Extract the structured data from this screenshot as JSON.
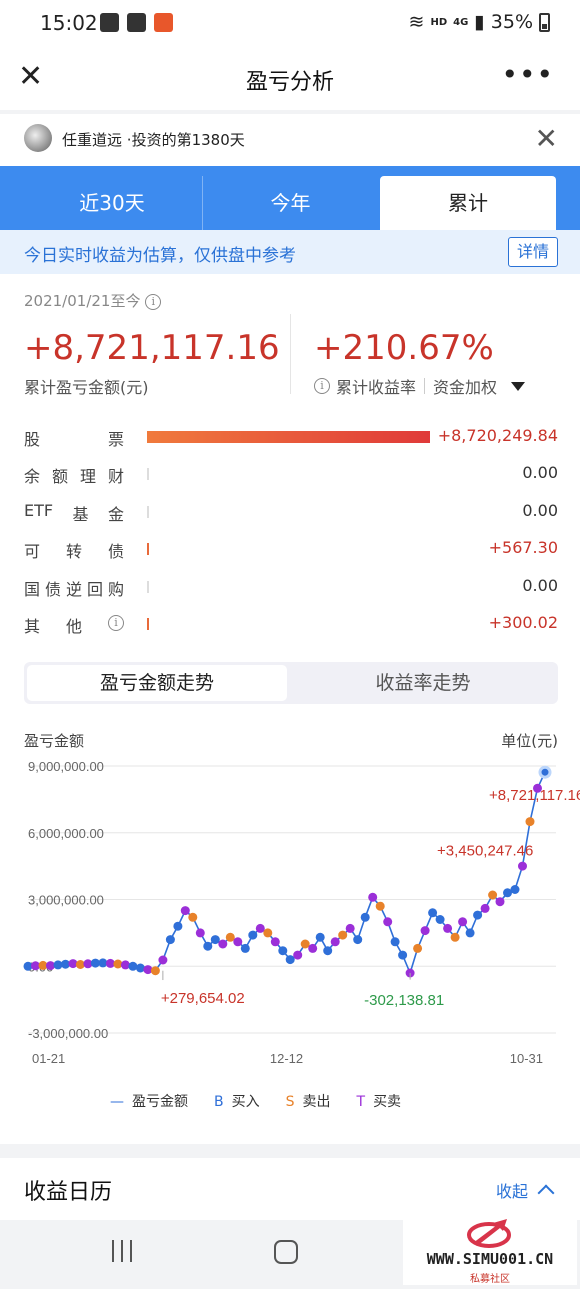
{
  "status_bar": {
    "time": "15:02",
    "hd": "HD",
    "network": "4G",
    "battery": "35%"
  },
  "nav": {
    "title": "盈亏分析"
  },
  "user": {
    "name": "任重道远",
    "invest_days": "·投资的第1380天"
  },
  "tabs": [
    {
      "label": "近30天",
      "active": false
    },
    {
      "label": "今年",
      "active": false
    },
    {
      "label": "累计",
      "active": true
    }
  ],
  "notice": {
    "text": "今日实时收益为估算，仅供盘中参考",
    "detail_label": "详情"
  },
  "summary": {
    "period": "2021/01/21至今",
    "total_pnl": "+8,721,117.16",
    "total_pnl_label": "累计盈亏金额(元)",
    "total_return": "+210.67%",
    "total_return_label": "累计收益率",
    "weighting_label": "资金加权"
  },
  "allocation": [
    {
      "chars": [
        "股",
        "票"
      ],
      "value": "+8,720,249.84",
      "fraction": 1.0,
      "color": "#e64a3a"
    },
    {
      "chars": [
        "余",
        "额",
        "理",
        "财"
      ],
      "value": "0.00",
      "fraction": 0.0,
      "color": "#dddddd"
    },
    {
      "chars": [
        "ETF",
        "基",
        "金"
      ],
      "value": "0.00",
      "fraction": 0.0,
      "color": "#dddddd"
    },
    {
      "chars": [
        "可",
        "转",
        "债"
      ],
      "value": "+567.30",
      "fraction": 7e-05,
      "color": "#e86a3a"
    },
    {
      "chars": [
        "国",
        "债",
        "逆",
        "回",
        "购"
      ],
      "value": "0.00",
      "fraction": 0.0,
      "color": "#dddddd"
    },
    {
      "chars": [
        "其",
        "他"
      ],
      "value": "+300.02",
      "fraction": 3e-05,
      "color": "#e86a3a",
      "info": true
    }
  ],
  "segments": {
    "left": "盈亏金额走势",
    "right": "收益率走势"
  },
  "chart_labels": {
    "ylabel": "盈亏金额",
    "unit": "单位(元)"
  },
  "chart_data": {
    "type": "line",
    "y_ticks": [
      "9,000,000.00",
      "6,000,000.00",
      "3,000,000.00",
      "0.00",
      "-3,000,000.00"
    ],
    "y_tick_values": [
      9000000,
      6000000,
      3000000,
      0,
      -3000000
    ],
    "ylim": [
      -3000000,
      9000000
    ],
    "x_ticks": [
      "01-21",
      "12-12",
      "10-31"
    ],
    "x_tick_positions": [
      0.0,
      0.5,
      1.0
    ],
    "series": [
      {
        "name": "盈亏金额",
        "values": [
          0,
          20000,
          40000,
          30000,
          60000,
          90000,
          120000,
          80000,
          110000,
          140000,
          150000,
          130000,
          100000,
          60000,
          0,
          -80000,
          -150000,
          -200000,
          279654.02,
          1200000,
          1800000,
          2500000,
          2200000,
          1500000,
          900000,
          1200000,
          1000000,
          1300000,
          1100000,
          800000,
          1400000,
          1700000,
          1500000,
          1100000,
          700000,
          300000,
          500000,
          1000000,
          800000,
          1300000,
          700000,
          1100000,
          1400000,
          1700000,
          1200000,
          2200000,
          3100000,
          2700000,
          2000000,
          1100000,
          500000,
          -302138.81,
          800000,
          1600000,
          2400000,
          2100000,
          1700000,
          1300000,
          2000000,
          1500000,
          2300000,
          2600000,
          3200000,
          2900000,
          3300000,
          3450247.46,
          4500000,
          6500000,
          8000000,
          8721117.16
        ]
      }
    ],
    "annotations": [
      {
        "text": "+8,721,117.16",
        "color": "#c8342a"
      },
      {
        "text": "+3,450,247.46",
        "color": "#c8342a"
      },
      {
        "text": "+279,654.02",
        "color": "#c8342a"
      },
      {
        "text": "-302,138.81",
        "color": "#2e9a4a"
      }
    ],
    "grid": true
  },
  "legend": [
    {
      "key": "—",
      "label": "盈亏金额",
      "color": "#2f6fd8"
    },
    {
      "key": "B",
      "label": "买入",
      "color": "#2f6fd8"
    },
    {
      "key": "S",
      "label": "卖出",
      "color": "#e8822a"
    },
    {
      "key": "T",
      "label": "买卖",
      "color": "#9b2fd8"
    }
  ],
  "calendar": {
    "title": "收益日历",
    "toggle_label": "收起"
  },
  "watermark": {
    "text": "WWW.SIMU001.CN",
    "sub": "私募社区"
  }
}
